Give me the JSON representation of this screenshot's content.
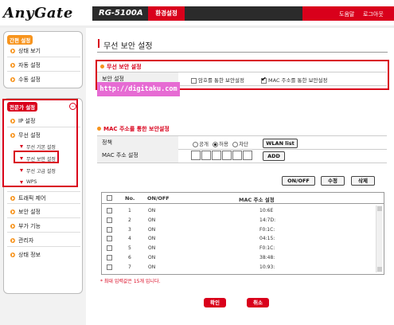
{
  "header": {
    "logo": "AnyGate",
    "model": "RG-5100A",
    "config_tab": "환경설정",
    "help_link": "도움말",
    "logout_link": "로그아웃"
  },
  "sidebar": {
    "simple_title": "간편 설정",
    "simple_items": [
      "상태 보기",
      "자동 설정",
      "수동 설정"
    ],
    "expert_title": "전문가 설정",
    "expert_items": [
      "IP 설정",
      "무선 설정"
    ],
    "wireless_sub": [
      "무선 기본 설정",
      "무선 보안 설정",
      "무선 고급 설정",
      "WPS"
    ],
    "more_items": [
      "트래픽 제어",
      "보안 설정",
      "부가 기능",
      "관리자",
      "상태 정보"
    ]
  },
  "main": {
    "page_title": "무선 보안 설정",
    "sec1_title": "무선 보안 설정",
    "sec1_label": "보안 설정",
    "opt_password": "암호를 통한 보안설정",
    "opt_mac": "MAC 주소를 통한 보안설정",
    "opt_password_checked": false,
    "opt_mac_checked": true,
    "watermark": "http://digitaku.com",
    "sec2_title": "MAC 주소를 통한 보안설정",
    "policy_label": "정책",
    "radio_open": "공개",
    "radio_allow": "허용",
    "radio_block": "차단",
    "selected_policy": "허용",
    "wlan_list_btn": "WLAN list",
    "mac_label": "MAC 주소 설정",
    "add_btn": "ADD",
    "onoff_btn": "ON/OFF",
    "edit_btn": "수정",
    "delete_btn": "삭제",
    "table": {
      "columns": [
        "No.",
        "ON/OFF",
        "MAC 주소 설정"
      ],
      "rows": [
        {
          "no": "1",
          "state": "ON",
          "mac": "10:6E"
        },
        {
          "no": "2",
          "state": "ON",
          "mac": "14:7D:"
        },
        {
          "no": "3",
          "state": "ON",
          "mac": "F0:1C:"
        },
        {
          "no": "4",
          "state": "ON",
          "mac": "04:15:"
        },
        {
          "no": "5",
          "state": "ON",
          "mac": "F0:1C:"
        },
        {
          "no": "6",
          "state": "ON",
          "mac": "38:48:"
        },
        {
          "no": "7",
          "state": "ON",
          "mac": "10:93:"
        }
      ]
    },
    "note": "* 최대 입력값은 15개 입니다.",
    "confirm_btn": "확인",
    "cancel_btn": "취소"
  },
  "colors": {
    "accent_red": "#d9001b",
    "accent_orange": "#f7941d",
    "dark_bar": "#2b2b2b"
  }
}
